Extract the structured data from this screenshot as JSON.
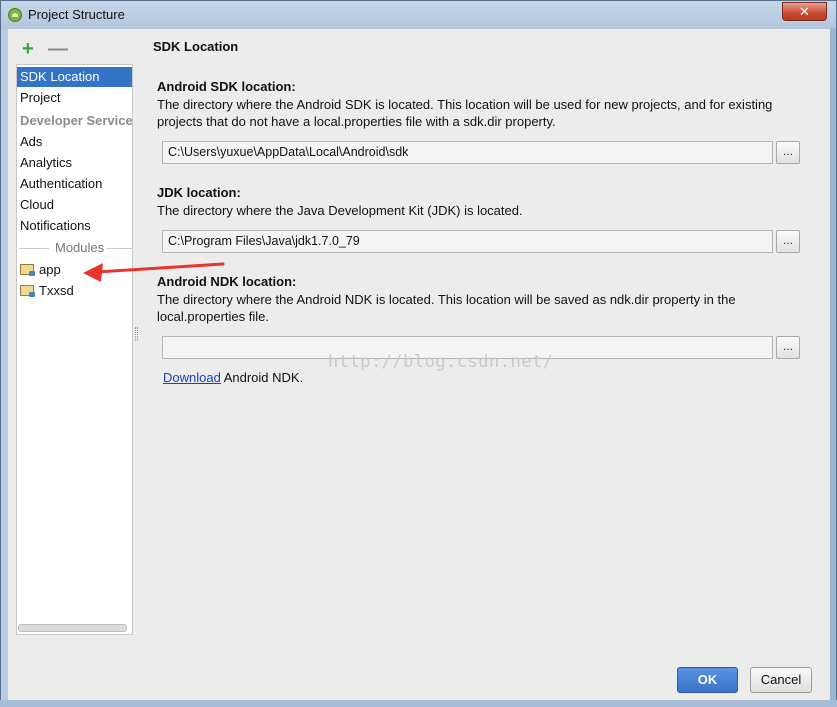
{
  "window": {
    "title": "Project Structure",
    "close_label": "✕"
  },
  "sidebar": {
    "toolbar": {
      "add": "+",
      "remove": "—"
    },
    "items": [
      {
        "label": "SDK Location",
        "selected": true
      },
      {
        "label": "Project"
      },
      {
        "label": "Developer Services",
        "header": true
      },
      {
        "label": "Ads"
      },
      {
        "label": "Analytics"
      },
      {
        "label": "Authentication"
      },
      {
        "label": "Cloud"
      },
      {
        "label": "Notifications"
      }
    ],
    "modules_label": "Modules",
    "modules": [
      {
        "label": "app",
        "icon": "module-folder-icon"
      },
      {
        "label": "Txxsd",
        "icon": "module-folder-icon"
      }
    ]
  },
  "content": {
    "title": "SDK Location",
    "android_sdk": {
      "title": "Android SDK location:",
      "desc_line1": "The directory where the Android SDK is located. This location will be used for new projects, and for existing",
      "desc_line2": "projects that do not have a local.properties file with a sdk.dir property.",
      "path": "C:\\Users\\yuxue\\AppData\\Local\\Android\\sdk",
      "browse": "..."
    },
    "jdk": {
      "title": "JDK location:",
      "desc_line1": "The directory where the Java Development Kit (JDK) is located.",
      "path": "C:\\Program Files\\Java\\jdk1.7.0_79",
      "browse": "..."
    },
    "ndk": {
      "title": "Android NDK location:",
      "desc_line1": "The directory where the Android NDK is located. This location will be saved as ndk.dir property in the",
      "desc_line2": "local.properties file.",
      "path": "",
      "browse": "...",
      "download_link": "Download",
      "download_suffix": " Android NDK."
    }
  },
  "watermark": "http://blog.csdn.net/",
  "buttons": {
    "ok": "OK",
    "cancel": "Cancel"
  },
  "colors": {
    "selection": "#3474c8",
    "ok_button": "#3a73c8",
    "link": "#1a3fc4",
    "arrow": "#e8352c"
  }
}
